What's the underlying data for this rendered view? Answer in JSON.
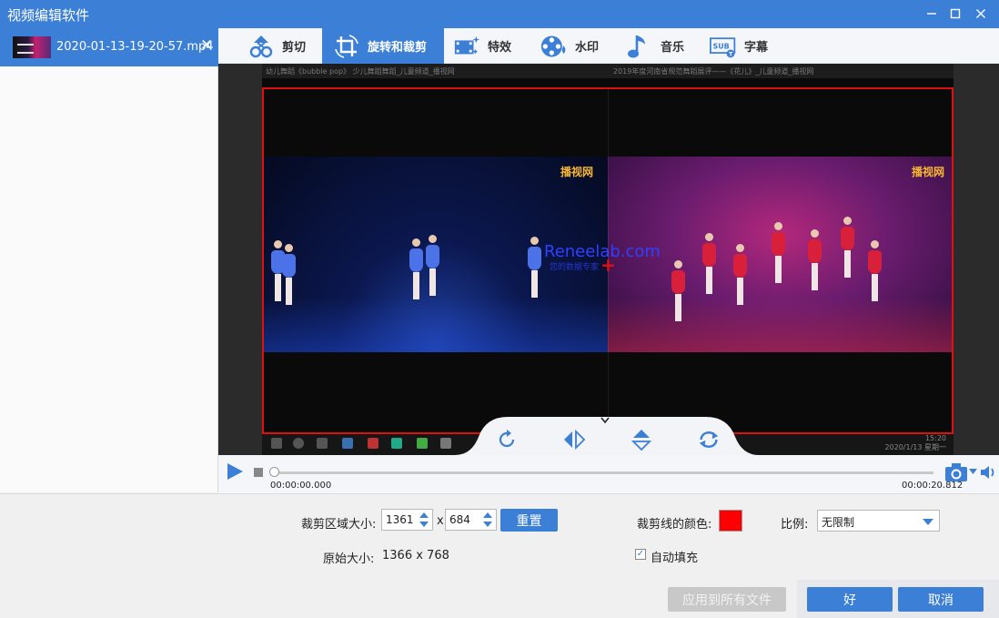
{
  "app": {
    "title": "视频编辑软件",
    "window_controls": {
      "minimize": "—",
      "maximize": "☐",
      "close": "✕"
    }
  },
  "files": [
    {
      "name": "2020-01-13-19-20-57.mp4",
      "close": "✕"
    }
  ],
  "tabs": [
    {
      "id": "cut",
      "label": "剪切",
      "icon": "scissors-icon"
    },
    {
      "id": "rotate",
      "label": "旋转和裁剪",
      "icon": "crop-rotate-icon",
      "active": true
    },
    {
      "id": "effects",
      "label": "特效",
      "icon": "effects-icon"
    },
    {
      "id": "watermark",
      "label": "水印",
      "icon": "film-reel-icon"
    },
    {
      "id": "music",
      "label": "音乐",
      "icon": "music-note-icon"
    },
    {
      "id": "subtitle",
      "label": "字幕",
      "icon": "subtitle-icon"
    }
  ],
  "preview": {
    "screen_tabs": {
      "left": "幼儿舞蹈《bubble pop》 少儿舞蹈舞蹈_儿童频道_播视网",
      "right": "2019年度河南省规范舞蹈展评——《花儿》_儿童频道_播视网"
    },
    "channel_logo": "播视网",
    "watermark": "Reneelab.com",
    "watermark_sub": "您的数据专家",
    "clock": {
      "time": "15:20",
      "date": "2020/1/13 星期一"
    }
  },
  "playback": {
    "current_time": "00:00:00.000",
    "total_time": "00:00:20.812",
    "progress": 0
  },
  "crop": {
    "area_label": "裁剪区域大小:",
    "width": "1361",
    "separator": "x",
    "height": "684",
    "reset_label": "重置",
    "original_label": "原始大小:",
    "original_value": "1366 x 768",
    "line_color_label": "裁剪线的颜色:",
    "line_color": "#ff0000",
    "ratio_label": "比例:",
    "ratio_value": "无限制",
    "autofill_label": "自动填充",
    "autofill_checked": true
  },
  "footer": {
    "apply_all_label": "应用到所有文件",
    "ok_label": "好",
    "cancel_label": "取消"
  },
  "colors": {
    "accent": "#3c7fd6",
    "crop_line": "#e01010"
  }
}
